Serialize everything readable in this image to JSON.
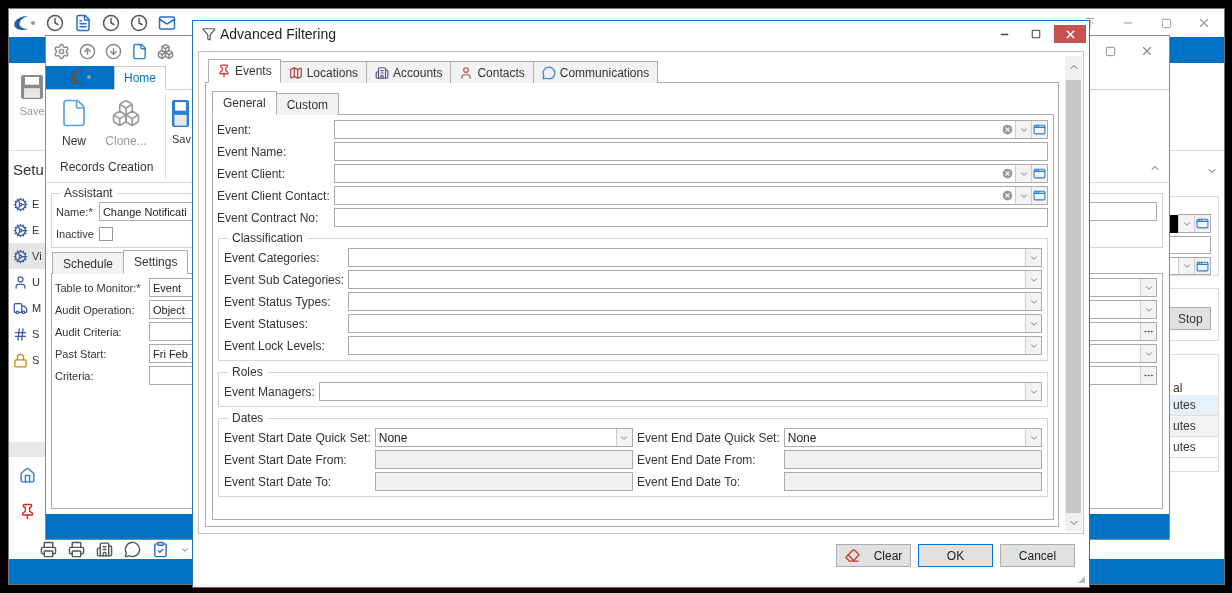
{
  "background_window": {
    "save_label": "Save",
    "section_title": "Setu",
    "sidebar_items": [
      {
        "label": "E",
        "selected": false
      },
      {
        "label": "E",
        "selected": false
      },
      {
        "label": "Vi",
        "selected": true
      },
      {
        "label": "U",
        "selected": false
      },
      {
        "label": "M",
        "selected": false
      },
      {
        "label": "S",
        "selected": false
      },
      {
        "label": "S",
        "selected": false
      }
    ],
    "stop_button": "Stop",
    "grid": {
      "header": "al",
      "rows": [
        {
          "cell": "utes",
          "selected": true
        },
        {
          "cell": "utes",
          "selected": false
        },
        {
          "cell": "utes",
          "selected": false
        }
      ]
    }
  },
  "record_window": {
    "ribbon_tab": "Home",
    "ribbon_buttons": [
      {
        "label": "New",
        "disabled": false
      },
      {
        "label": "Clone...",
        "disabled": true
      },
      {
        "label": "Sav",
        "disabled": false
      }
    ],
    "ribbon_group": "Records Creation",
    "assistant": {
      "title": "Assistant",
      "name_label": "Name:*",
      "name_value": "Change Notificati",
      "inactive_label": "Inactive",
      "inactive_checked": false
    },
    "tabs": [
      {
        "label": "Schedule",
        "selected": false
      },
      {
        "label": "Settings",
        "selected": true
      }
    ],
    "fields": [
      {
        "label": "Table to Monitor:*",
        "value": "Event",
        "kind": "dropdown"
      },
      {
        "label": "Audit Operation:",
        "value": "Object",
        "kind": "dropdown"
      },
      {
        "label": "Audit Criteria:",
        "kind": "ellipsis"
      },
      {
        "label": "Past Start:",
        "value": "Fri Feb",
        "kind": "dropdown"
      },
      {
        "label": "Criteria:",
        "kind": "ellipsis"
      }
    ]
  },
  "dialog": {
    "title": "Advanced Filtering",
    "tabs": [
      {
        "label": "Events",
        "selected": true
      },
      {
        "label": "Locations",
        "selected": false
      },
      {
        "label": "Accounts",
        "selected": false
      },
      {
        "label": "Contacts",
        "selected": false
      },
      {
        "label": "Communications",
        "selected": false
      }
    ],
    "subtabs": [
      {
        "label": "General",
        "selected": true
      },
      {
        "label": "Custom",
        "selected": false
      }
    ],
    "fields": [
      {
        "label": "Event:",
        "kind": "lookup"
      },
      {
        "label": "Event Name:",
        "kind": "text"
      },
      {
        "label": "Event Client:",
        "kind": "lookup"
      },
      {
        "label": "Event Client Contact:",
        "kind": "lookup"
      },
      {
        "label": "Event Contract No:",
        "kind": "text"
      }
    ],
    "groups": [
      {
        "title": "Classification",
        "fields": [
          {
            "label": "Event Categories:",
            "kind": "dropdown"
          },
          {
            "label": "Event Sub Categories:",
            "kind": "dropdown"
          },
          {
            "label": "Event Status Types:",
            "kind": "dropdown"
          },
          {
            "label": "Event Statuses:",
            "kind": "dropdown"
          },
          {
            "label": "Event Lock Levels:",
            "kind": "dropdown"
          }
        ]
      },
      {
        "title": "Roles",
        "fields": [
          {
            "label": "Event Managers:",
            "kind": "dropdown"
          }
        ]
      }
    ],
    "dates": {
      "title": "Dates",
      "fields": [
        {
          "label": "Event Start Date Quick Set:",
          "kind": "dropdown",
          "value": "None",
          "disabled": false
        },
        {
          "label": "Event End Date Quick Set:",
          "kind": "dropdown",
          "value": "None",
          "disabled": false
        },
        {
          "label": "Event Start Date From:",
          "kind": "date",
          "disabled": true
        },
        {
          "label": "Event End Date From:",
          "kind": "date",
          "disabled": true
        },
        {
          "label": "Event Start Date To:",
          "kind": "date",
          "disabled": true
        },
        {
          "label": "Event End Date To:",
          "kind": "date",
          "disabled": true
        }
      ]
    },
    "buttons": [
      {
        "label": "Clear",
        "kind": "icon",
        "default": false
      },
      {
        "label": "OK",
        "kind": "plain",
        "default": true
      },
      {
        "label": "Cancel",
        "kind": "plain",
        "default": false
      }
    ]
  }
}
